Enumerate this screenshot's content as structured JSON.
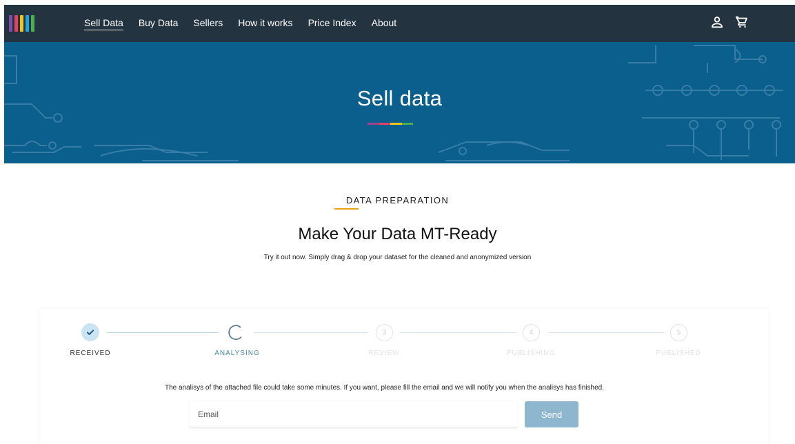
{
  "nav": {
    "logo_colors": [
      "#7b4fa3",
      "#e0406a",
      "#f0c419",
      "#1ba6e0",
      "#4caf50"
    ],
    "links": [
      {
        "label": "Sell Data",
        "active": true
      },
      {
        "label": "Buy Data",
        "active": false
      },
      {
        "label": "Sellers",
        "active": false
      },
      {
        "label": "How it works",
        "active": false
      },
      {
        "label": "Price Index",
        "active": false
      },
      {
        "label": "About",
        "active": false
      }
    ],
    "icons": [
      "user-icon",
      "cart-icon"
    ]
  },
  "hero": {
    "title": "Sell data",
    "stripe_colors": [
      "#a0408f",
      "#e0406a",
      "#f0c419",
      "#4caf50"
    ],
    "background": "#0b5f8c"
  },
  "section": {
    "eyebrow": "DATA PREPARATION",
    "accent": "#e8a319",
    "heading": "Make Your Data MT-Ready",
    "subheading": "Try it out now. Simply drag & drop your dataset for the cleaned and anonymized version"
  },
  "stepper": {
    "steps": [
      {
        "label": "RECEIVED",
        "state": "done",
        "marker": "check-icon"
      },
      {
        "label": "ANALYSING",
        "state": "active",
        "marker": "spinner-icon"
      },
      {
        "label": "REVIEW",
        "state": "pending",
        "number": "3"
      },
      {
        "label": "PUBLISHING",
        "state": "pending",
        "number": "4"
      },
      {
        "label": "PUBLISHED",
        "state": "pending",
        "number": "5"
      }
    ]
  },
  "notice": "The analisys of the attached file could take some minutes. If you want, please fill the email and we will notify you when the analisys has finished.",
  "form": {
    "email_placeholder": "Email",
    "email_value": "",
    "send_label": "Send"
  }
}
